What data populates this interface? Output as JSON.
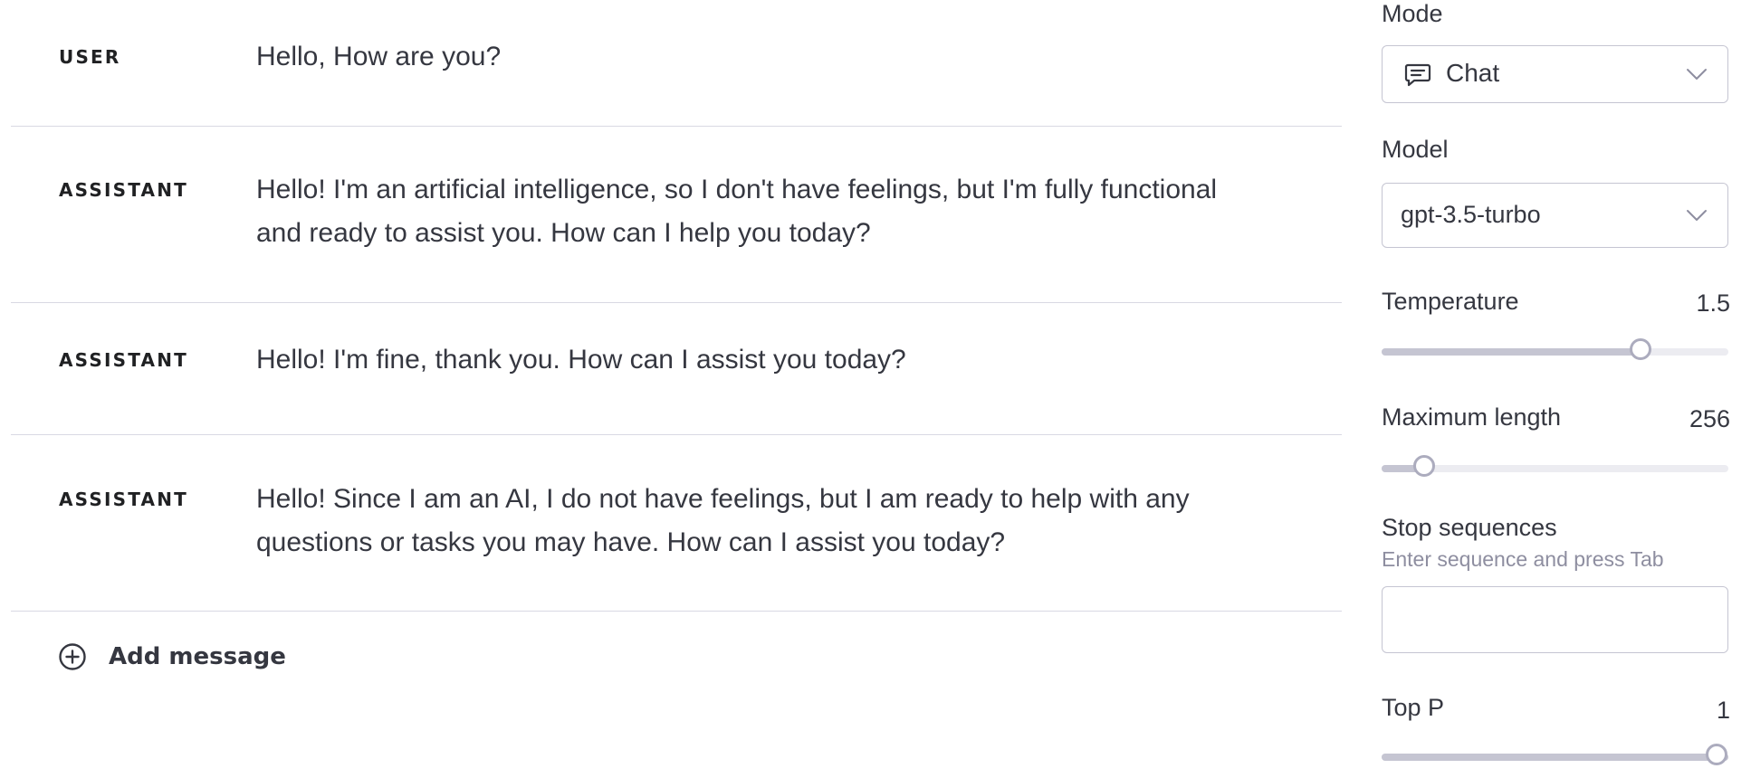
{
  "messages": [
    {
      "role": "USER",
      "content": "Hello, How are you?"
    },
    {
      "role": "ASSISTANT",
      "content": "Hello! I'm an artificial intelligence, so I don't have feelings, but I'm fully functional and ready to assist you. How can I help you today?"
    },
    {
      "role": "ASSISTANT",
      "content": "Hello! I'm fine, thank you. How can I assist you today?"
    },
    {
      "role": "ASSISTANT",
      "content": "Hello! Since I am an AI, I do not have feelings, but I am ready to help with any questions or tasks you may have. How can I assist you today?"
    }
  ],
  "add_message": {
    "label": "Add message",
    "icon": "plus-circle-icon"
  },
  "settings": {
    "mode": {
      "label": "Mode",
      "value": "Chat",
      "icon": "chat-bubble-icon"
    },
    "model": {
      "label": "Model",
      "value": "gpt-3.5-turbo"
    },
    "temperature": {
      "label": "Temperature",
      "value": "1.5",
      "fraction": 0.75
    },
    "maximum_length": {
      "label": "Maximum length",
      "value": "256",
      "fraction": 0.125
    },
    "stop_sequences": {
      "label": "Stop sequences",
      "hint": "Enter sequence and press Tab",
      "value": ""
    },
    "top_p": {
      "label": "Top P",
      "value": "1",
      "fraction": 1.0
    }
  },
  "colors": {
    "text": "#353740",
    "border": "#d9d9e3",
    "input_border": "#c5c5d2",
    "slider_track": "#ececf1",
    "slider_fill": "#c5c5d2",
    "slider_thumb": "#acacbe",
    "hint": "#8e8ea0"
  }
}
